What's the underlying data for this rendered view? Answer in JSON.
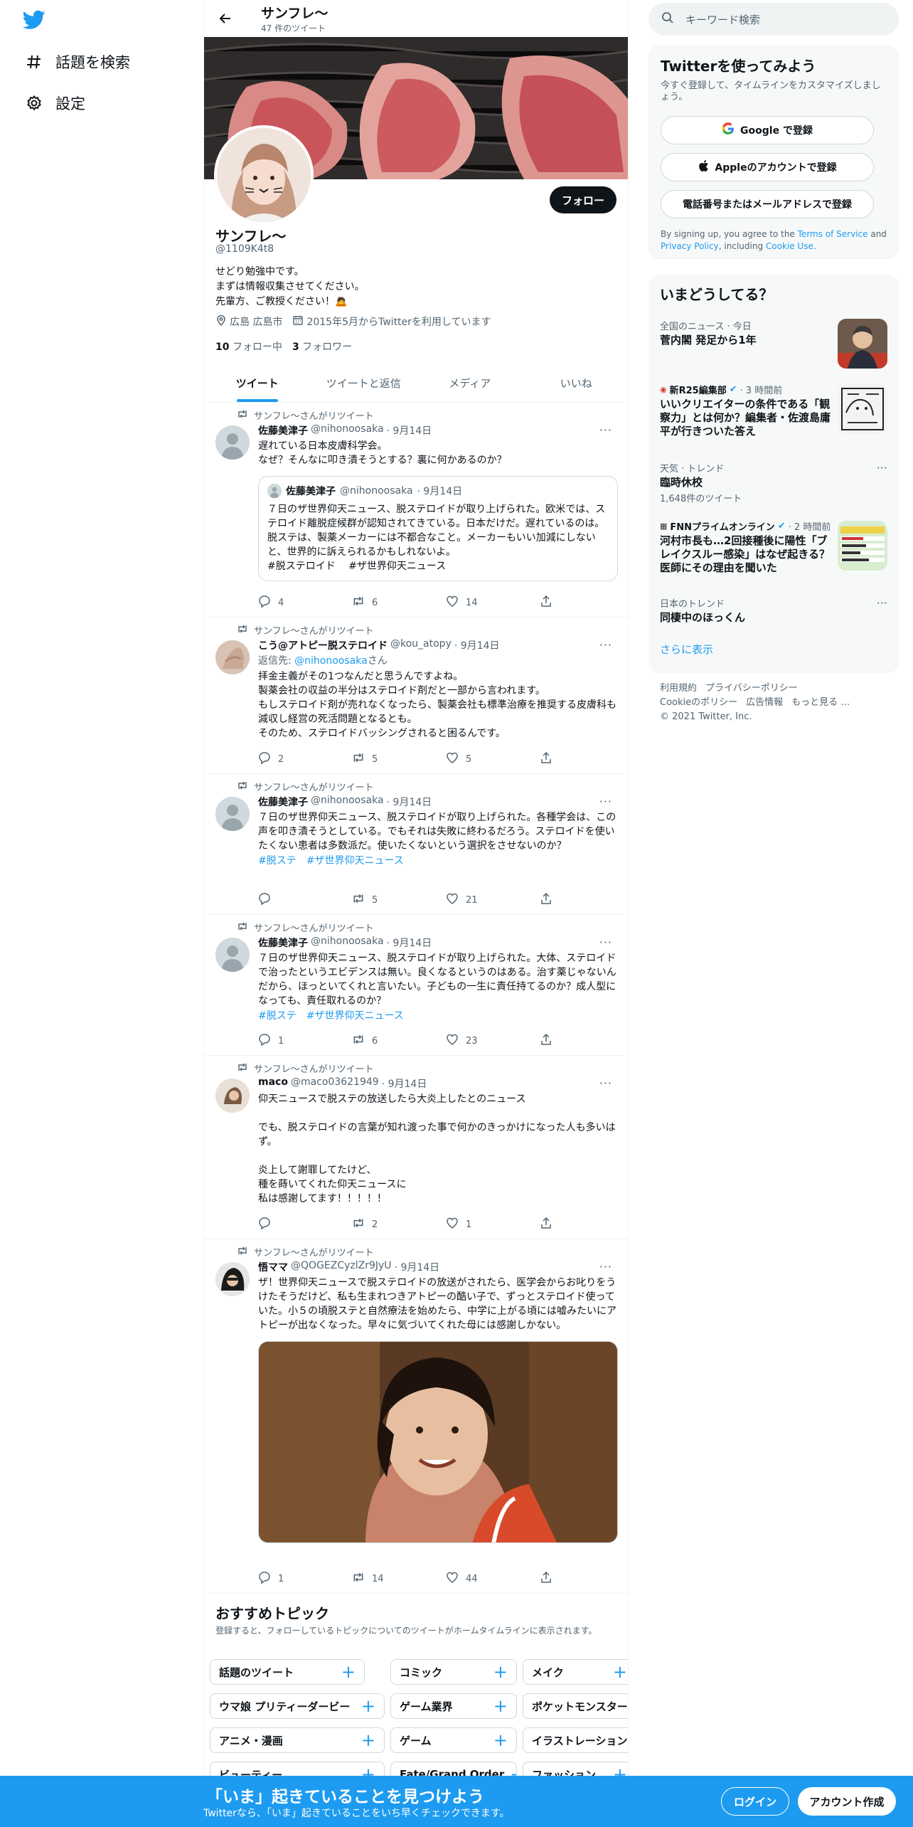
{
  "nav": {
    "explore": "話題を検索",
    "settings": "設定"
  },
  "header": {
    "name": "サンフレ〜",
    "tweet_count": "47 件のツイート"
  },
  "profile": {
    "name": "サンフレ〜",
    "handle": "@1109K4t8",
    "bio_1": "せどり勉強中です。",
    "bio_2": "まずは情報収集させてください。",
    "bio_3": "先輩方、ご教授ください！🙇",
    "location": "広島 広島市",
    "joined": "2015年5月からTwitterを利用しています",
    "following_count": "10",
    "following_label": "フォロー中",
    "followers_count": "3",
    "followers_label": "フォロワー",
    "follow_button": "フォロー"
  },
  "tabs": [
    "ツイート",
    "ツイートと返信",
    "メディア",
    "いいね"
  ],
  "retweet_label": "サンフレ〜さんがリツイート",
  "tweets": [
    {
      "name": "佐藤美津子",
      "handle": "@nihonoosaka",
      "date": "· 9月14日",
      "text": "遅れている日本皮膚科学会。\nなぜ？そんなに叩き潰そうとする？裏に何かあるのか？",
      "quote": {
        "name": "佐藤美津子",
        "handle": "@nihonoosaka",
        "date": "· 9月14日",
        "text": "７日のザ世界仰天ニュース、脱ステロイドが取り上げられた。欧米では、ステロイド離脱症候群が認知されてきている。日本だけだ。遅れているのは。脱ステは、製薬メーカーには不都合なこと。メーカーもいい加減にしないと、世界的に訴えられるかもしれないよ。\n#脱ステロイド　 #ザ世界仰天ニュース"
      },
      "replies": "4",
      "retweets": "6",
      "likes": "14"
    },
    {
      "name": "こう@アトピー脱ステロイド",
      "handle": "@kou_atopy",
      "date": "· 9月14日",
      "reply_prefix": "返信先: ",
      "reply_handle": "@nihonoosaka",
      "reply_suffix": "さん",
      "text": "拝金主義がその1つなんだと思うんですよね。\n製薬会社の収益の半分はステロイド剤だと一部から言われます。\nもしステロイド剤が売れなくなったら、製薬会社も標準治療を推奨する皮膚科も減収し経営の死活問題となるとも。\nそのため、ステロイドバッシングされると困るんです。",
      "replies": "2",
      "retweets": "5",
      "likes": "5"
    },
    {
      "name": "佐藤美津子",
      "handle": "@nihonoosaka",
      "date": "· 9月14日",
      "text": "７日のザ世界仰天ニュース、脱ステロイドが取り上げられた。各種学会は、この声を叩き潰そうとしている。でもそれは失敗に終わるだろう。ステロイドを使いたくない患者は多数派だ。使いたくないという選択をさせないのか？",
      "tags": [
        "#脱ステ",
        "#ザ世界仰天ニュース"
      ],
      "replies": "",
      "retweets": "5",
      "likes": "21"
    },
    {
      "name": "佐藤美津子",
      "handle": "@nihonoosaka",
      "date": "· 9月14日",
      "text": "７日のザ世界仰天ニュース、脱ステロイドが取り上げられた。大体、ステロイドで治ったというエビデンスは無い。良くなるというのはある。治す薬じゃないんだから、ほっといてくれと言いたい。子どもの一生に責任持てるのか？成人型になっても、責任取れるのか？",
      "tags": [
        "#脱ステ",
        "#ザ世界仰天ニュース"
      ],
      "replies": "1",
      "retweets": "6",
      "likes": "23"
    },
    {
      "name": "maco",
      "handle": "@maco03621949",
      "date": "· 9月14日",
      "text": "仰天ニュースで脱ステの放送したら大炎上したとのニュース\n\nでも、脱ステロイドの言葉が知れ渡った事で何かのきっかけになった人も多いはず。\n\n炎上して謝罪してたけど、\n種を蒔いてくれた仰天ニュースに\n私は感謝してます！！！！！",
      "replies": "",
      "retweets": "2",
      "likes": "1"
    },
    {
      "name": "悟ママ",
      "handle": "@QOGEZCyzlZr9JyU",
      "date": "· 9月14日",
      "text": "ザ！世界仰天ニュースで脱ステロイドの放送がされたら、医学会からお叱りをうけたそうだけど、私も生まれつきアトピーの酷い子で、ずっとステロイド使っていた。小５の頃脱ステと自然療法を始めたら、中学に上がる頃には嘘みたいにアトピーが出なくなった。早々に気づいてくれた母には感謝しかない。",
      "replies": "1",
      "retweets": "14",
      "likes": "44"
    }
  ],
  "topics": {
    "title": "おすすめトピック",
    "subtitle": "登録すると、フォローしているトピックについてのツイートがホームタイムラインに表示されます。",
    "chips": [
      "話題のツイート",
      "コミック",
      "メイク",
      "ウマ娘 プリティーダービー",
      "ゲーム業界",
      "ポケットモンスター",
      "アニメ・漫画",
      "ゲーム",
      "イラストレーション",
      "ビューティー",
      "Fate/Grand Order",
      "ファッション"
    ]
  },
  "sidebar": {
    "search_placeholder": "キーワード検索",
    "join_title": "Twitterを使ってみよう",
    "join_sub": "今すぐ登録して、タイムラインをカスタマイズしましょう。",
    "google_btn": "Google で登録",
    "apple_btn": "Appleのアカウントで登録",
    "phone_btn": "電話番号またはメールアドレスで登録",
    "terms_1": "By signing up, you agree to the ",
    "terms_tos": "Terms of Service",
    "terms_2": " and ",
    "terms_pp": "Privacy Policy",
    "terms_3": ", including ",
    "terms_cookie": "Cookie Use",
    "terms_4": ".",
    "trends_title": "いまどうしてる？",
    "trends": [
      {
        "meta": "全国のニュース · 今日",
        "name": "菅内閣 発足から1年"
      },
      {
        "meta_source": "新R25編集部",
        "meta_time": "· 3 時間前",
        "name": "いいクリエイターの条件である「観察力」とは何か？編集者・佐渡島庸平が行きついた答え"
      },
      {
        "meta": "天気 · トレンド",
        "name": "臨時休校",
        "count": "1,648件のツイート"
      },
      {
        "meta_source": "FNNプライムオンライン",
        "meta_time": "· 2 時間前",
        "name": "河村市長も…2回接種後に陽性「ブレイクスルー感染」はなぜ起きる？ 医師にその理由を聞いた"
      },
      {
        "meta": "日本のトレンド",
        "name": "同棲中のほっくん"
      }
    ],
    "show_more": "さらに表示",
    "footer_links": [
      "利用規約",
      "プライバシーポリシー",
      "Cookieのポリシー",
      "広告情報",
      "もっと見る …"
    ],
    "copyright": "© 2021 Twitter, Inc."
  },
  "bottom_bar": {
    "headline": "「いま」起きていることを見つけよう",
    "sub": "Twitterなら、「いま」起きていることをいち早くチェックできます。",
    "login": "ログイン",
    "signup": "アカウント作成"
  },
  "colors": {
    "accent": "#1d9bf0",
    "text": "#0f1419",
    "muted": "#536471"
  }
}
